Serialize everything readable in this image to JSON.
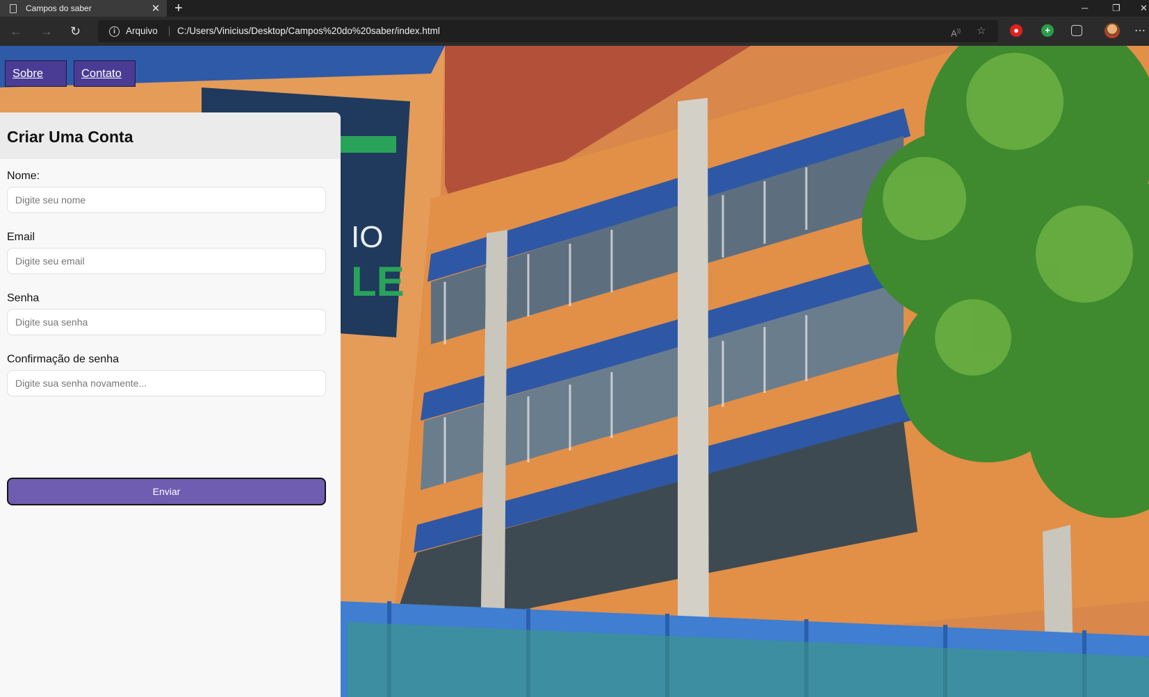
{
  "browser": {
    "tab_title": "Campos do saber",
    "tab_close": "✕",
    "new_tab": "+",
    "protocol_label": "Arquivo",
    "url": "C:/Users/Vinicius/Desktop/Campos%20do%20saber/index.html",
    "icons": [
      "back-icon",
      "forward-icon",
      "reload-icon",
      "info-icon",
      "read-aloud-icon",
      "favorites-icon",
      "extension-icon",
      "puzzle-icon",
      "profile-avatar",
      "more-icon"
    ]
  },
  "nav": {
    "links": [
      {
        "label": "Sobre"
      },
      {
        "label": "Contato"
      }
    ]
  },
  "form": {
    "title": "Criar Uma Conta",
    "fields": [
      {
        "label": "Nome:",
        "placeholder": "Digite seu nome"
      },
      {
        "label": "Email",
        "placeholder": "Digite seu email"
      },
      {
        "label": "Senha",
        "placeholder": "Digite sua senha"
      },
      {
        "label": "Confirmação de senha",
        "placeholder": "Digite sua senha novamente..."
      }
    ],
    "submit_label": "Enviar"
  },
  "colors": {
    "nav_link_bg": "#4a3b94",
    "submit_bg": "#6f5db1",
    "panel_bg": "#f8f8f8",
    "panel_header_bg": "#ebebeb",
    "building_orange": "#e2934f",
    "building_blue": "#2f5aa8"
  }
}
